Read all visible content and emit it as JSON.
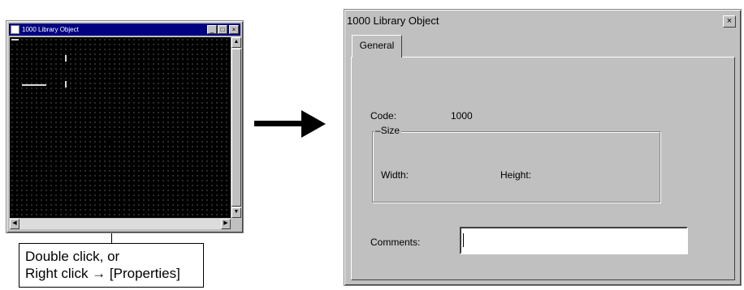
{
  "small_window": {
    "title": "1000 Library Object",
    "buttons": {
      "minimize": "_",
      "maximize": "□",
      "close": "×"
    },
    "scroll_arrows": {
      "up": "▲",
      "down": "▼",
      "left": "◀",
      "right": "▶"
    }
  },
  "annotation": {
    "line1": "Double click, or",
    "line2": "Right click → [Properties]"
  },
  "dialog": {
    "title": "1000 Library Object",
    "close_label": "×",
    "tabs": [
      {
        "label": "General",
        "active": true
      }
    ],
    "code_label": "Code:",
    "code_value": "1000",
    "size_group_label": "Size",
    "width_label": "Width:",
    "width_value": "",
    "height_label": "Height:",
    "height_value": "",
    "comments_label": "Comments:",
    "comments_value": ""
  },
  "colors": {
    "window_face": "#c0c0c0",
    "canvas": "#000000",
    "title_active": "#000080"
  }
}
